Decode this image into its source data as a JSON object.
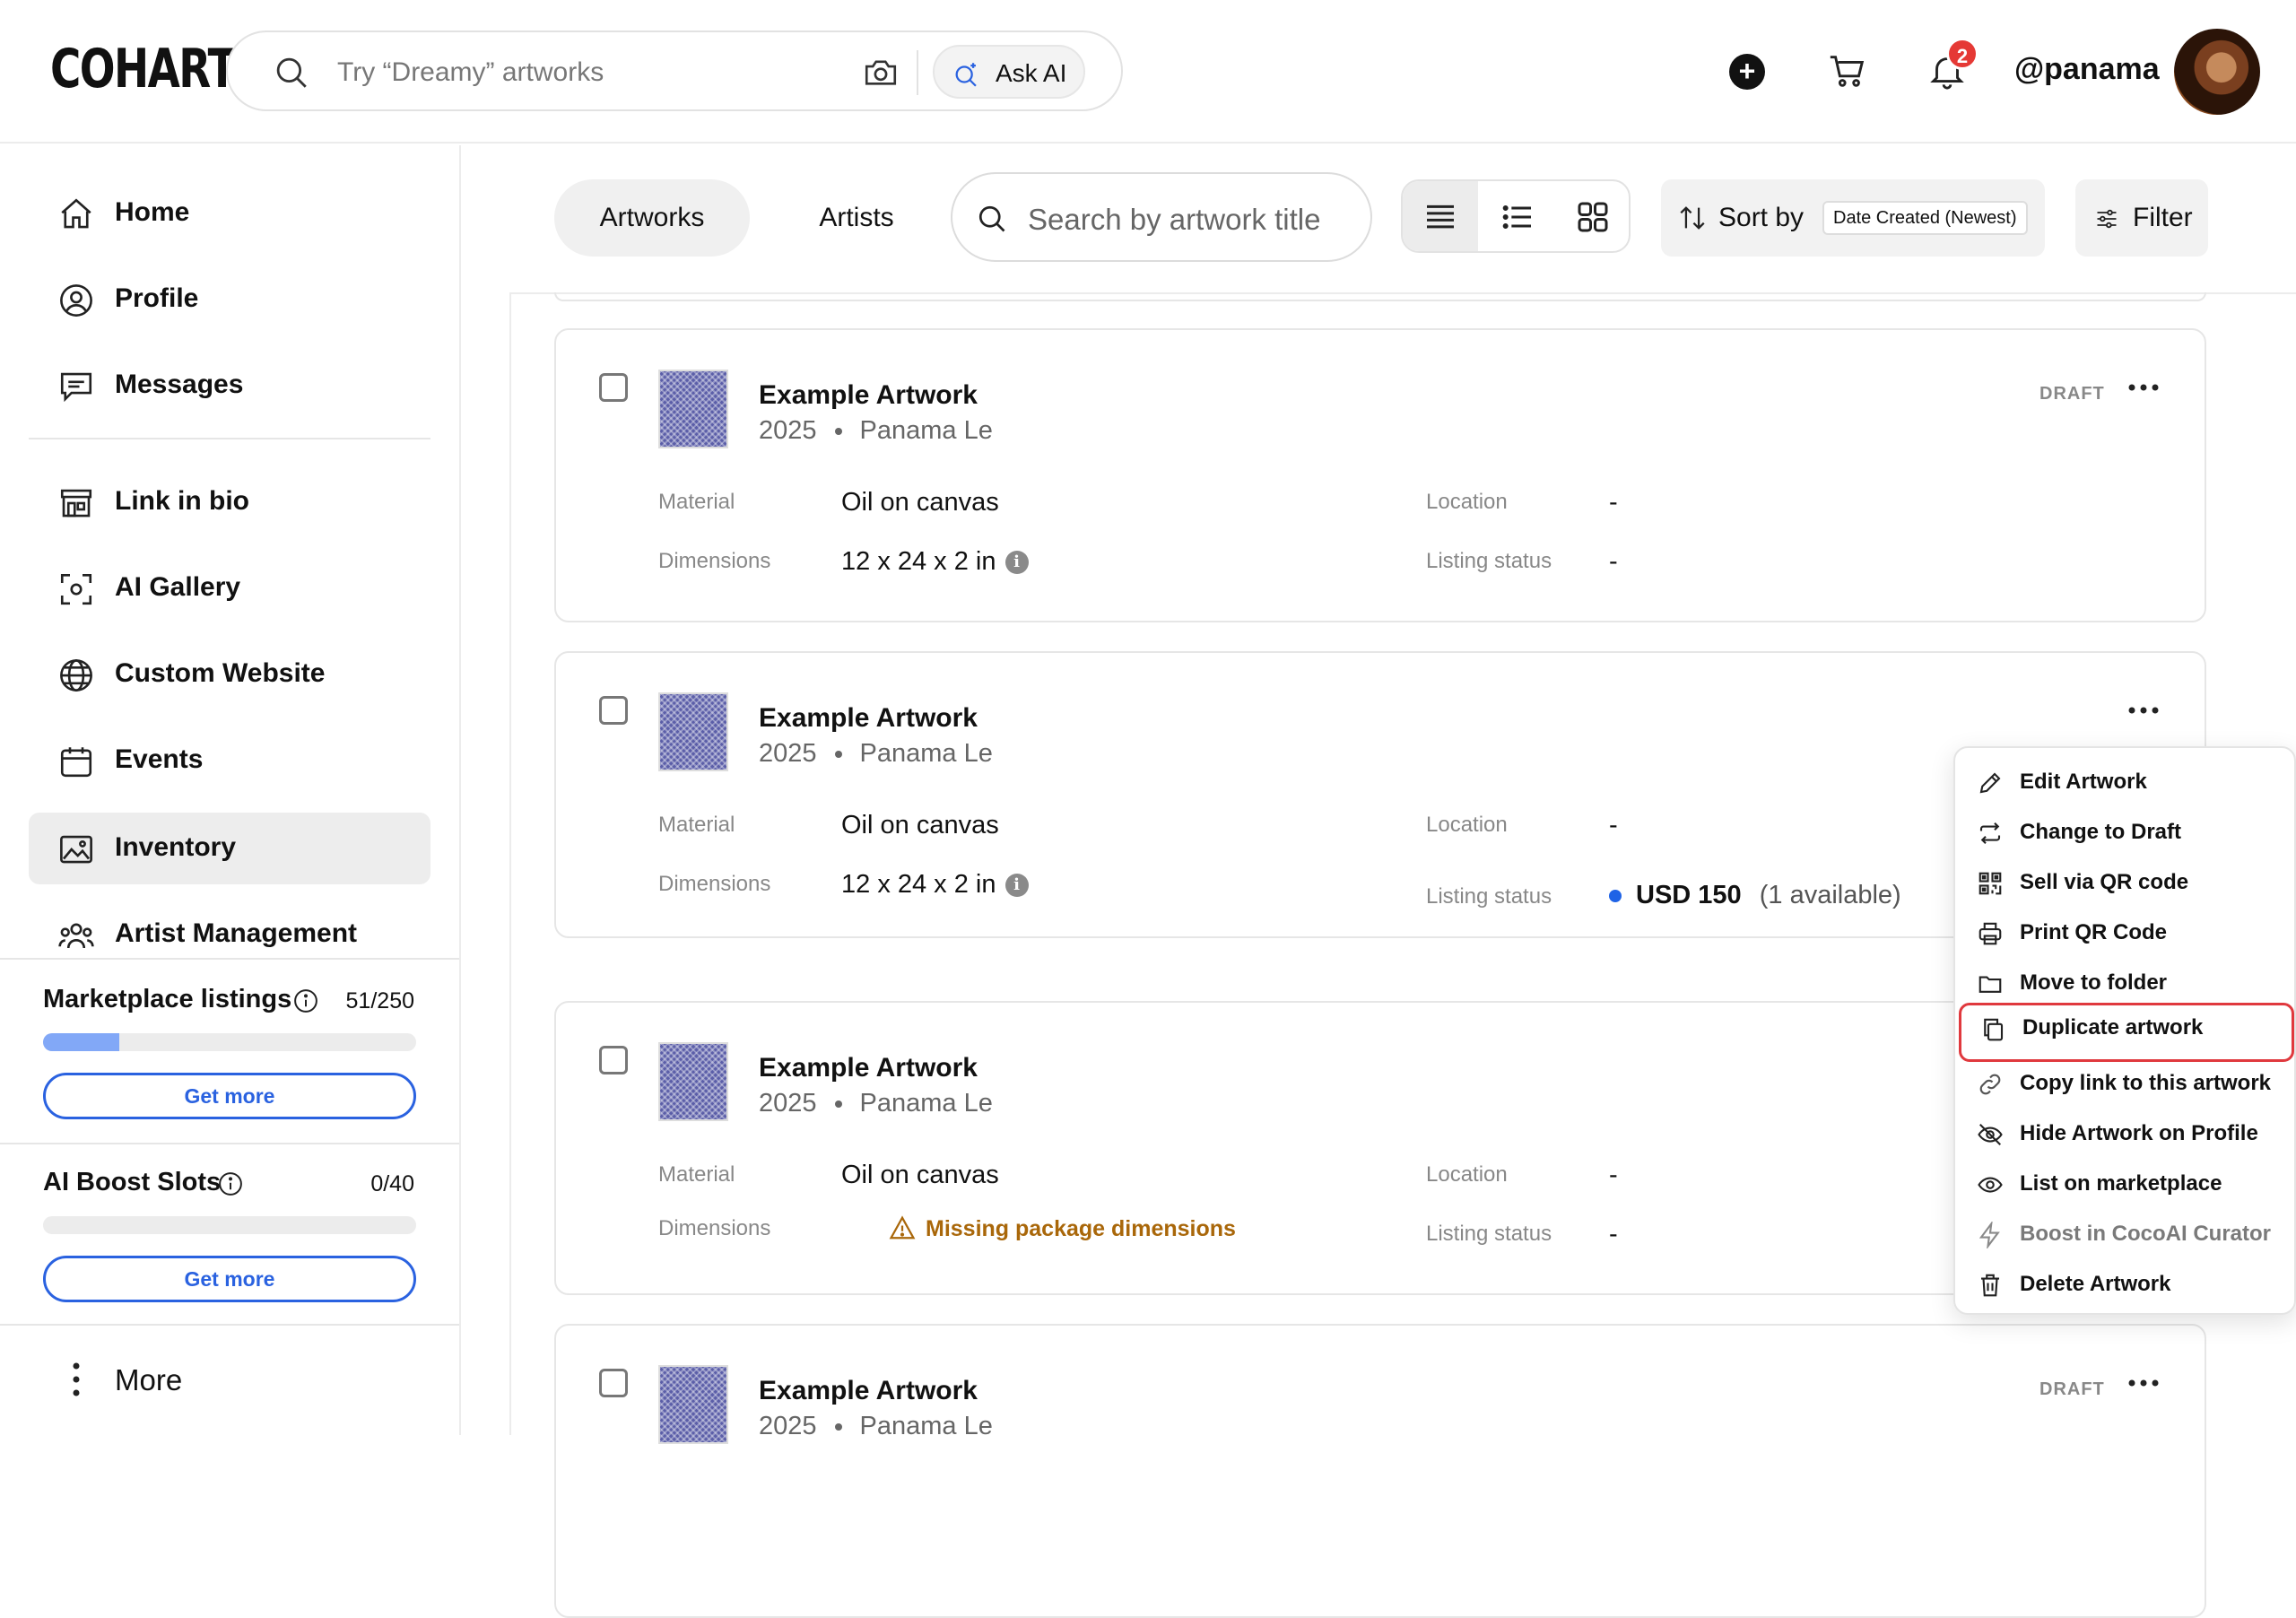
{
  "header": {
    "logo": "COHART",
    "search_placeholder": "Try “Dreamy” artworks",
    "ask_ai_label": "Ask AI",
    "notification_count": "2",
    "username": "@panama"
  },
  "sidebar": {
    "items": [
      {
        "label": "Home",
        "icon": "home-icon"
      },
      {
        "label": "Profile",
        "icon": "user-circle-icon"
      },
      {
        "label": "Messages",
        "icon": "chat-icon"
      },
      {
        "label": "Link in bio",
        "icon": "storefront-icon"
      },
      {
        "label": "AI Gallery",
        "icon": "scan-icon"
      },
      {
        "label": "Custom Website",
        "icon": "globe-icon"
      },
      {
        "label": "Events",
        "icon": "calendar-icon"
      },
      {
        "label": "Inventory",
        "icon": "image-icon",
        "active": true
      },
      {
        "label": "Artist Management",
        "icon": "users-icon"
      }
    ],
    "marketplace": {
      "title": "Marketplace listings",
      "count": "51/250",
      "used": 51,
      "limit": 250,
      "button": "Get more"
    },
    "ai_boost": {
      "title": "AI Boost Slots",
      "count": "0/40",
      "used": 0,
      "limit": 40,
      "button": "Get more"
    },
    "more_label": "More"
  },
  "toolbar": {
    "tabs": [
      "Artworks",
      "Artists"
    ],
    "active_tab": "Artworks",
    "search_placeholder": "Search by artwork title",
    "sort_label": "Sort by",
    "sort_value": "Date Created (Newest)",
    "filter_label": "Filter"
  },
  "labels": {
    "material": "Material",
    "dimensions": "Dimensions",
    "location": "Location",
    "listing_status": "Listing status"
  },
  "artworks": [
    {
      "title": "Example Artwork",
      "year": "2025",
      "artist": "Panama Le",
      "material": "Oil on canvas",
      "dimensions": "12 x 24 x 2 in",
      "location": "-",
      "listing_status": "-",
      "badge": "DRAFT"
    },
    {
      "title": "Example Artwork",
      "year": "2025",
      "artist": "Panama Le",
      "material": "Oil on canvas",
      "dimensions": "12 x 24 x 2 in",
      "location": "-",
      "listing_price": "USD 150",
      "listing_avail": "(1 available)",
      "badge": ""
    },
    {
      "title": "Example Artwork",
      "year": "2025",
      "artist": "Panama Le",
      "material": "Oil on canvas",
      "dimensions_warning": "Missing package dimensions",
      "location": "-",
      "listing_status": "-",
      "badge": ""
    },
    {
      "title": "Example Artwork",
      "year": "2025",
      "artist": "Panama Le",
      "badge": "DRAFT"
    }
  ],
  "menu": {
    "items": [
      {
        "label": "Edit Artwork",
        "icon": "pencil-icon"
      },
      {
        "label": "Change to Draft",
        "icon": "repeat-icon"
      },
      {
        "label": "Sell via QR code",
        "icon": "qr-code-icon"
      },
      {
        "label": "Print QR Code",
        "icon": "printer-icon"
      },
      {
        "label": "Move to folder",
        "icon": "folder-icon"
      },
      {
        "label": "Duplicate artwork",
        "icon": "copy-icon",
        "highlighted": true
      },
      {
        "label": "Copy link to this artwork",
        "icon": "link-icon"
      },
      {
        "label": "Hide Artwork on Profile",
        "icon": "eye-off-icon"
      },
      {
        "label": "List on marketplace",
        "icon": "eye-icon"
      },
      {
        "label": "Boost in CocoAI Curator",
        "icon": "bolt-icon",
        "disabled": true
      },
      {
        "label": "Delete Artwork",
        "icon": "trash-icon"
      }
    ]
  },
  "colors": {
    "accent_blue": "#2a62e0",
    "progress_fill": "#82a8f7",
    "highlight_red": "#e0393e",
    "warning": "#a9670a",
    "badge_red": "#e53935"
  }
}
